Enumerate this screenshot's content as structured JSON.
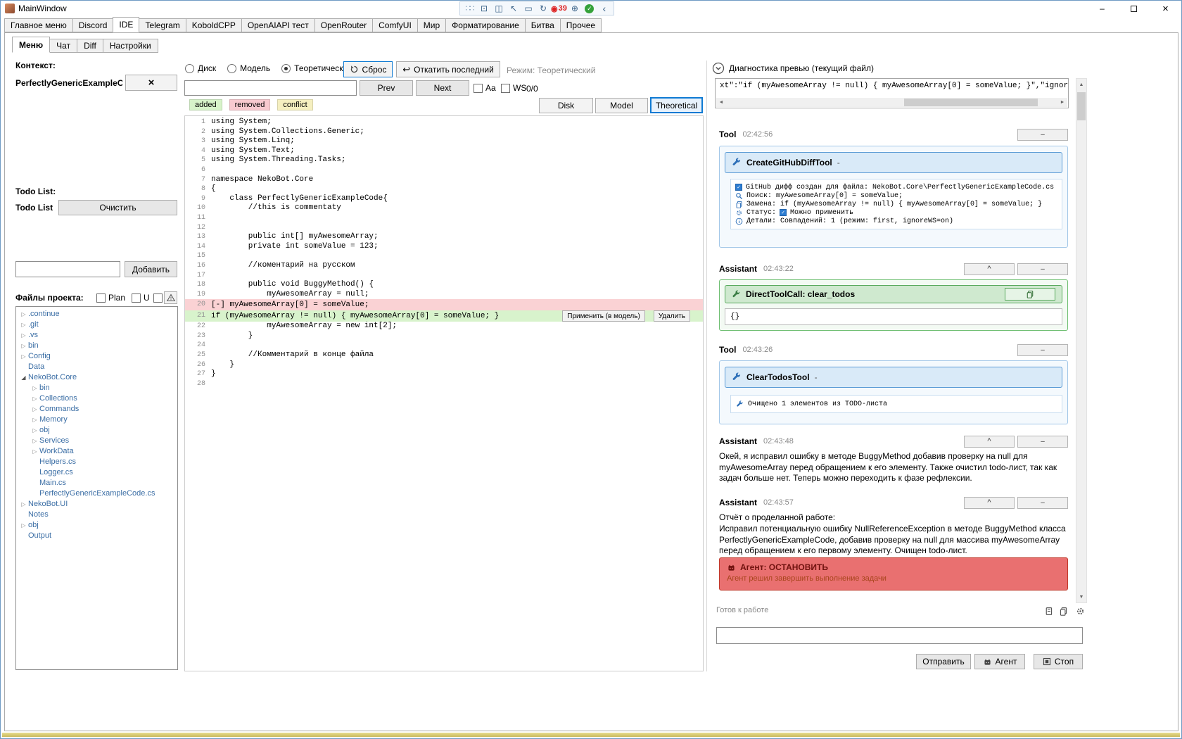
{
  "window": {
    "title": "MainWindow",
    "overlay": {
      "record_count": "39"
    }
  },
  "main_tabs": {
    "items": [
      "Главное меню",
      "Discord",
      "IDE",
      "Telegram",
      "KoboldCPP",
      "OpenAIAPI тест",
      "OpenRouter",
      "ComfyUI",
      "Мир",
      "Форматирование",
      "Битва",
      "Прочее"
    ],
    "active": "IDE"
  },
  "sub_tabs": {
    "items": [
      "Меню",
      "Чат",
      "Diff",
      "Настройки"
    ],
    "active": "Меню"
  },
  "left_panel": {
    "context_label": "Контекст:",
    "context_value": "PerfectlyGenericExampleCoc",
    "todo_header": "Todo List:",
    "todo_list_label": "Todo List",
    "clear_button": "Очистить",
    "add_input_value": "",
    "add_button": "Добавить",
    "files_label": "Файлы проекта:",
    "plan_label": "Plan",
    "u_label": "U",
    "tree": [
      {
        "label": ".continue",
        "depth": 0,
        "arrow": "c"
      },
      {
        "label": ".git",
        "depth": 0,
        "arrow": "c"
      },
      {
        "label": ".vs",
        "depth": 0,
        "arrow": "c"
      },
      {
        "label": "bin",
        "depth": 0,
        "arrow": "c"
      },
      {
        "label": "Config",
        "depth": 0,
        "arrow": "c"
      },
      {
        "label": "Data",
        "depth": 0,
        "arrow": "n"
      },
      {
        "label": "NekoBot.Core",
        "depth": 0,
        "arrow": "e"
      },
      {
        "label": "bin",
        "depth": 1,
        "arrow": "c"
      },
      {
        "label": "Collections",
        "depth": 1,
        "arrow": "c"
      },
      {
        "label": "Commands",
        "depth": 1,
        "arrow": "c"
      },
      {
        "label": "Memory",
        "depth": 1,
        "arrow": "c"
      },
      {
        "label": "obj",
        "depth": 1,
        "arrow": "c"
      },
      {
        "label": "Services",
        "depth": 1,
        "arrow": "c"
      },
      {
        "label": "WorkData",
        "depth": 1,
        "arrow": "c"
      },
      {
        "label": "Helpers.cs",
        "depth": 1,
        "arrow": "n"
      },
      {
        "label": "Logger.cs",
        "depth": 1,
        "arrow": "n"
      },
      {
        "label": "Main.cs",
        "depth": 1,
        "arrow": "n"
      },
      {
        "label": "PerfectlyGenericExampleCode.cs",
        "depth": 1,
        "arrow": "n"
      },
      {
        "label": "NekoBot.UI",
        "depth": 0,
        "arrow": "c"
      },
      {
        "label": "Notes",
        "depth": 0,
        "arrow": "n"
      },
      {
        "label": "obj",
        "depth": 0,
        "arrow": "c"
      },
      {
        "label": "Output",
        "depth": 0,
        "arrow": "n"
      }
    ]
  },
  "editor": {
    "radios": [
      "Диск",
      "Модель",
      "Теоретический"
    ],
    "active_radio": "Теоретический",
    "reset_button": "Сброс",
    "undo_button": "Откатить последний",
    "mode_label": "Режим: Теоретический",
    "search_value": "",
    "prev_button": "Prev",
    "next_button": "Next",
    "aa_label": "Aa",
    "ws_label": "WS",
    "counter": "0/0",
    "disk_button": "Disk",
    "model_button": "Model",
    "theoretical_button": "Theoretical",
    "legend": [
      {
        "label": "added",
        "key": "added"
      },
      {
        "label": "removed",
        "key": "removed"
      },
      {
        "label": "conflict",
        "key": "conflict"
      }
    ],
    "apply_button": "Применить (в модель)",
    "delete_button": "Удалить",
    "lines": [
      {
        "n": 1,
        "t": "using System;",
        "k": "n"
      },
      {
        "n": 2,
        "t": "using System.Collections.Generic;",
        "k": "n"
      },
      {
        "n": 3,
        "t": "using System.Linq;",
        "k": "n"
      },
      {
        "n": 4,
        "t": "using System.Text;",
        "k": "n"
      },
      {
        "n": 5,
        "t": "using System.Threading.Tasks;",
        "k": "n"
      },
      {
        "n": 6,
        "t": "",
        "k": "n"
      },
      {
        "n": 7,
        "t": "namespace NekoBot.Core",
        "k": "n"
      },
      {
        "n": 8,
        "t": "{",
        "k": "n"
      },
      {
        "n": 9,
        "t": "    class PerfectlyGenericExampleCode{",
        "k": "n"
      },
      {
        "n": 10,
        "t": "        //this is commentaty",
        "k": "n"
      },
      {
        "n": 11,
        "t": "",
        "k": "n"
      },
      {
        "n": 12,
        "t": "",
        "k": "n"
      },
      {
        "n": 13,
        "t": "        public int[] myAwesomeArray;",
        "k": "n"
      },
      {
        "n": 14,
        "t": "        private int someValue = 123;",
        "k": "n"
      },
      {
        "n": 15,
        "t": "",
        "k": "n"
      },
      {
        "n": 16,
        "t": "        //коментарий на русском",
        "k": "n"
      },
      {
        "n": 17,
        "t": "",
        "k": "n"
      },
      {
        "n": 18,
        "t": "        public void BuggyMethod() {",
        "k": "n"
      },
      {
        "n": 19,
        "t": "            myAwesomeArray = null;",
        "k": "n"
      },
      {
        "n": 20,
        "t": "[-] myAwesomeArray[0] = someValue;",
        "k": "removed"
      },
      {
        "n": 21,
        "t": "if (myAwesomeArray != null) { myAwesomeArray[0] = someValue; }",
        "k": "added",
        "buttons": true
      },
      {
        "n": 22,
        "t": "            myAwesomeArray = new int[2];",
        "k": "n"
      },
      {
        "n": 23,
        "t": "        }",
        "k": "n"
      },
      {
        "n": 24,
        "t": "",
        "k": "n"
      },
      {
        "n": 25,
        "t": "        //Комментарий в конце файла",
        "k": "n"
      },
      {
        "n": 26,
        "t": "    }",
        "k": "n"
      },
      {
        "n": 27,
        "t": "}",
        "k": "n"
      },
      {
        "n": 28,
        "t": "",
        "k": "n"
      }
    ]
  },
  "right_panel": {
    "header": "Диагностика превью (текущий файл)",
    "preview_text": "xt\":\"if (myAwesomeArray != null) { myAwesomeArray[0] = someValue; }\",\"ignorewhitespace",
    "messages": [
      {
        "role": "Tool",
        "time": "02:42:56",
        "tool_name": "CreateGitHubDiffTool",
        "tool_dash": "-",
        "rows": [
          {
            "text": "GitHub дифф создан для файла: NekoBot.Core\\PerfectlyGenericExampleCode.cs"
          },
          {
            "text": "Поиск: myAwesomeArray[0] = someValue;"
          },
          {
            "text": "Замена: if (myAwesomeArray != null) { myAwesomeArray[0] = someValue; }"
          },
          {
            "before": "Статус:",
            "after": "Можно применить"
          },
          {
            "text": "Детали: Совпадений: 1 (режим: first, ignoreWS=on)"
          }
        ]
      },
      {
        "role": "Assistant",
        "time": "02:43:22",
        "toolcall_title": "DirectToolCall: clear_todos",
        "toolcall_body": "{}"
      },
      {
        "role": "Tool",
        "time": "02:43:26",
        "tool_name": "ClearTodosTool",
        "tool_dash": "-",
        "result": "Очищено 1 элементов из TODO-листа"
      },
      {
        "role": "Assistant",
        "time": "02:43:48",
        "text": "Окей, я исправил ошибку в методе BuggyMethod добавив проверку на null для myAwesomeArray перед обращением к его элементу. Также очистил todo-лист, так как задач больше нет. Теперь можно переходить к фазе рефлексии."
      },
      {
        "role": "Assistant",
        "time": "02:43:57",
        "title_line": "Отчёт о проделанной работе:",
        "text": "Исправил потенциальную ошибку NullReferenceException в методе BuggyMethod класса PerfectlyGenericExampleCode, добавив проверку на null для массива myAwesomeArray перед обращением к его первому элементу. Очищен todo-лист.",
        "agent_title": "Агент: ОСТАНОВИТЬ",
        "agent_subtitle": "Агент решил завершить выполнение задачи"
      }
    ],
    "status": "Готов к работе",
    "input_value": "",
    "send_button": "Отправить",
    "agent_button": "Агент",
    "stop_button": "Стоп"
  }
}
